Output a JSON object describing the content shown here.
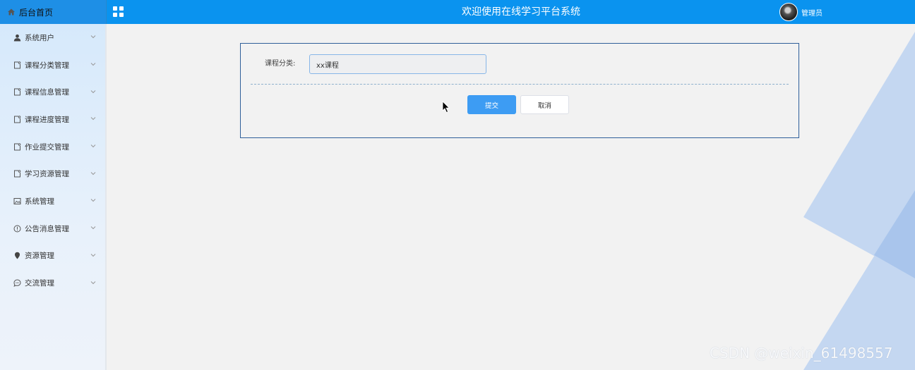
{
  "header": {
    "brand": "后台首页",
    "title": "欢迎使用在线学习平台系统",
    "user_name": "管理员"
  },
  "sidebar": {
    "items": [
      {
        "label": "系统用户",
        "icon": "user-icon"
      },
      {
        "label": "课程分类管理",
        "icon": "doc-icon"
      },
      {
        "label": "课程信息管理",
        "icon": "doc-icon"
      },
      {
        "label": "课程进度管理",
        "icon": "doc-icon"
      },
      {
        "label": "作业提交管理",
        "icon": "doc-icon"
      },
      {
        "label": "学习资源管理",
        "icon": "doc-icon"
      },
      {
        "label": "系统管理",
        "icon": "picture-icon"
      },
      {
        "label": "公告消息管理",
        "icon": "info-icon"
      },
      {
        "label": "资源管理",
        "icon": "pin-icon"
      },
      {
        "label": "交流管理",
        "icon": "chat-icon"
      }
    ]
  },
  "form": {
    "category_label": "课程分类:",
    "category_value": "xx课程",
    "submit_label": "提交",
    "cancel_label": "取消"
  },
  "watermark": "CSDN @weixin_61498557",
  "colors": {
    "header_bg": "#0a93ef",
    "accent": "#3d9cf3",
    "panel_border": "#2f5f9a"
  }
}
